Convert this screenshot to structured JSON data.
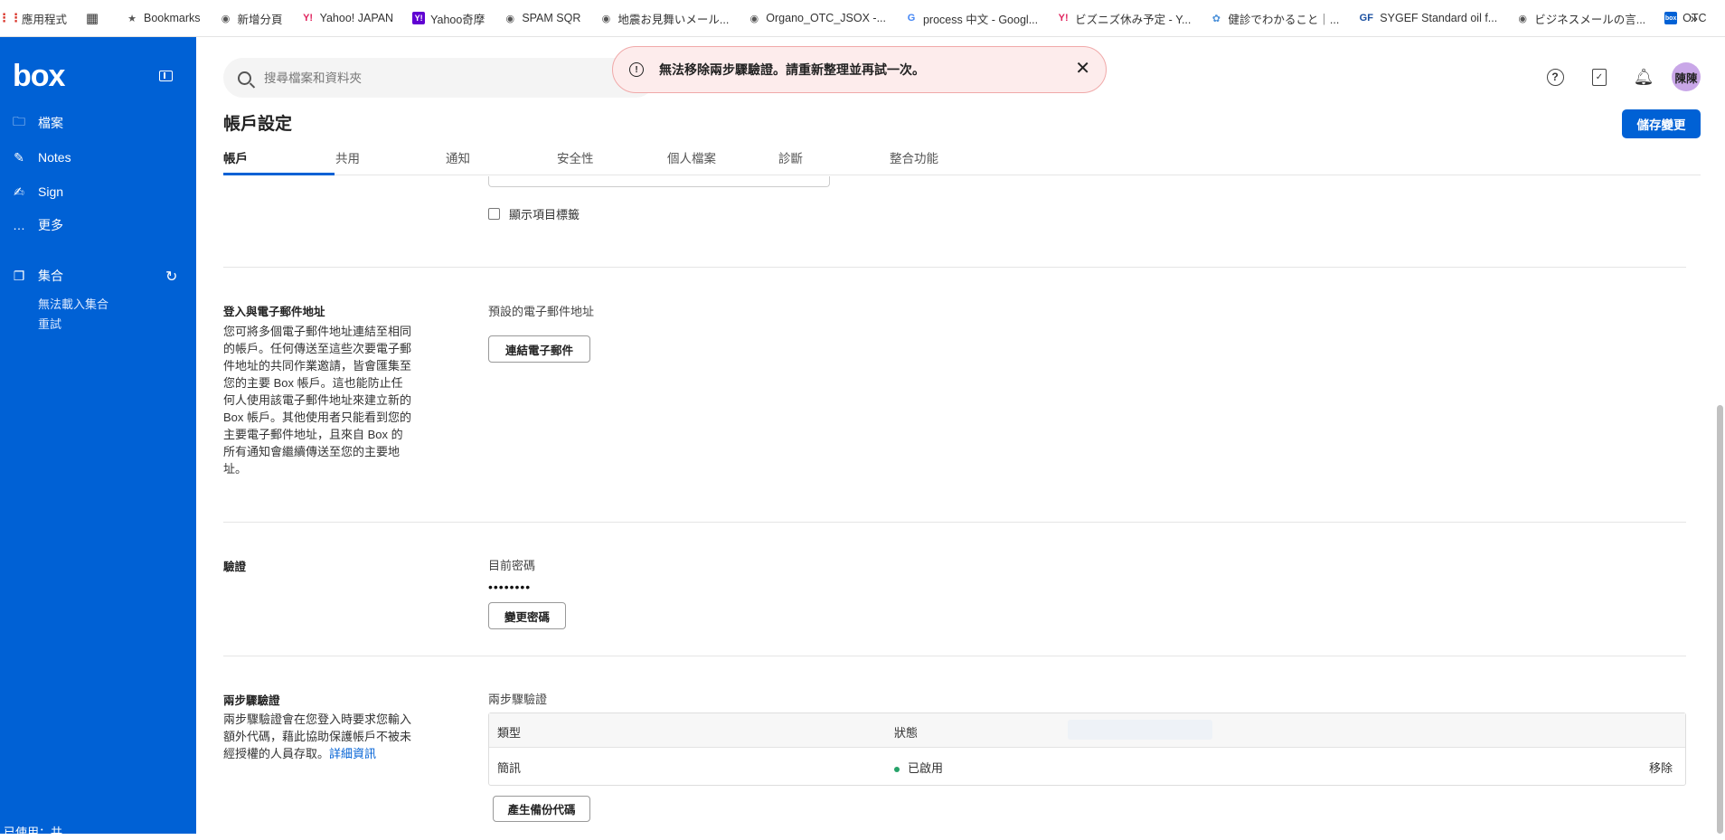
{
  "bookmarks": {
    "items": [
      {
        "label": "應用程式",
        "icon": "apps-grid-icon"
      },
      {
        "label": "",
        "icon": "tab-grid-icon"
      },
      {
        "label": "Bookmarks",
        "icon": "star-icon"
      },
      {
        "label": "新增分頁",
        "icon": "globe-icon"
      },
      {
        "label": "Yahoo! JAPAN",
        "icon": "yahoo-icon"
      },
      {
        "label": "Yahoo奇摩",
        "icon": "yahoo-square-icon"
      },
      {
        "label": "SPAM SQR",
        "icon": "globe-icon"
      },
      {
        "label": "地震お見舞いメール...",
        "icon": "globe-icon"
      },
      {
        "label": "Organo_OTC_JSOX -...",
        "icon": "globe-icon"
      },
      {
        "label": "process 中文 - Googl...",
        "icon": "google-icon"
      },
      {
        "label": "ビズニズ休み予定 - Y...",
        "icon": "yahoo-icon"
      },
      {
        "label": "健診でわかること｜...",
        "icon": "health-icon"
      },
      {
        "label": "SYGEF Standard oil f...",
        "icon": "gf-icon"
      },
      {
        "label": "ビジネスメールの言...",
        "icon": "globe-icon"
      },
      {
        "label": "OTC",
        "icon": "box-icon"
      }
    ],
    "more": "»"
  },
  "sidebar": {
    "logo": "box",
    "items": [
      {
        "label": "檔案",
        "icon": "folder-icon"
      },
      {
        "label": "Notes",
        "icon": "notes-icon"
      },
      {
        "label": "Sign",
        "icon": "sign-icon"
      },
      {
        "label": "更多",
        "icon": "more-icon"
      }
    ],
    "collections": {
      "label": "集合",
      "error": "無法載入集合",
      "retry": "重試"
    },
    "quota": "已使用：共"
  },
  "header": {
    "search_placeholder": "搜尋檔案和資料夾",
    "avatar": "陳陳"
  },
  "toast": {
    "message": "無法移除兩步驟驗證。請重新整理並再試一次。",
    "close": "✕"
  },
  "page": {
    "title": "帳戶設定",
    "save_label": "儲存變更",
    "tabs": [
      "帳戶",
      "共用",
      "通知",
      "安全性",
      "個人檔案",
      "診斷",
      "整合功能"
    ]
  },
  "sections": {
    "show_labels": "顯示項目標籤",
    "login_email": {
      "title": "登入與電子郵件地址",
      "description": "您可將多個電子郵件地址連結至相同的帳戶。任何傳送至這些次要電子郵件地址的共同作業邀請，皆會匯集至您的主要 Box 帳戶。這也能防止任何人使用該電子郵件地址來建立新的 Box 帳戶。其他使用者只能看到您的主要電子郵件地址，且來自 Box 的所有通知會繼續傳送至您的主要地址。",
      "field_label": "預設的電子郵件地址",
      "button": "連結電子郵件"
    },
    "auth": {
      "title": "驗證",
      "field_label": "目前密碼",
      "password_mask": "••••••••",
      "button": "變更密碼"
    },
    "two_step": {
      "title": "兩步驟驗證",
      "description": "兩步驟驗證會在您登入時要求您輸入額外代碼，藉此協助保護帳戶不被未經授權的人員存取。",
      "more_link": "詳細資訊",
      "field_label": "兩步驟驗證",
      "table": {
        "headers": [
          "類型",
          "狀態"
        ],
        "rows": [
          {
            "type": "簡訊",
            "status": "已啟用",
            "action": "移除"
          }
        ]
      },
      "backup_button": "產生備份代碼"
    }
  },
  "colors": {
    "brand": "#0061d5",
    "toast_bg": "#fdecec",
    "status_green": "#26a269"
  }
}
